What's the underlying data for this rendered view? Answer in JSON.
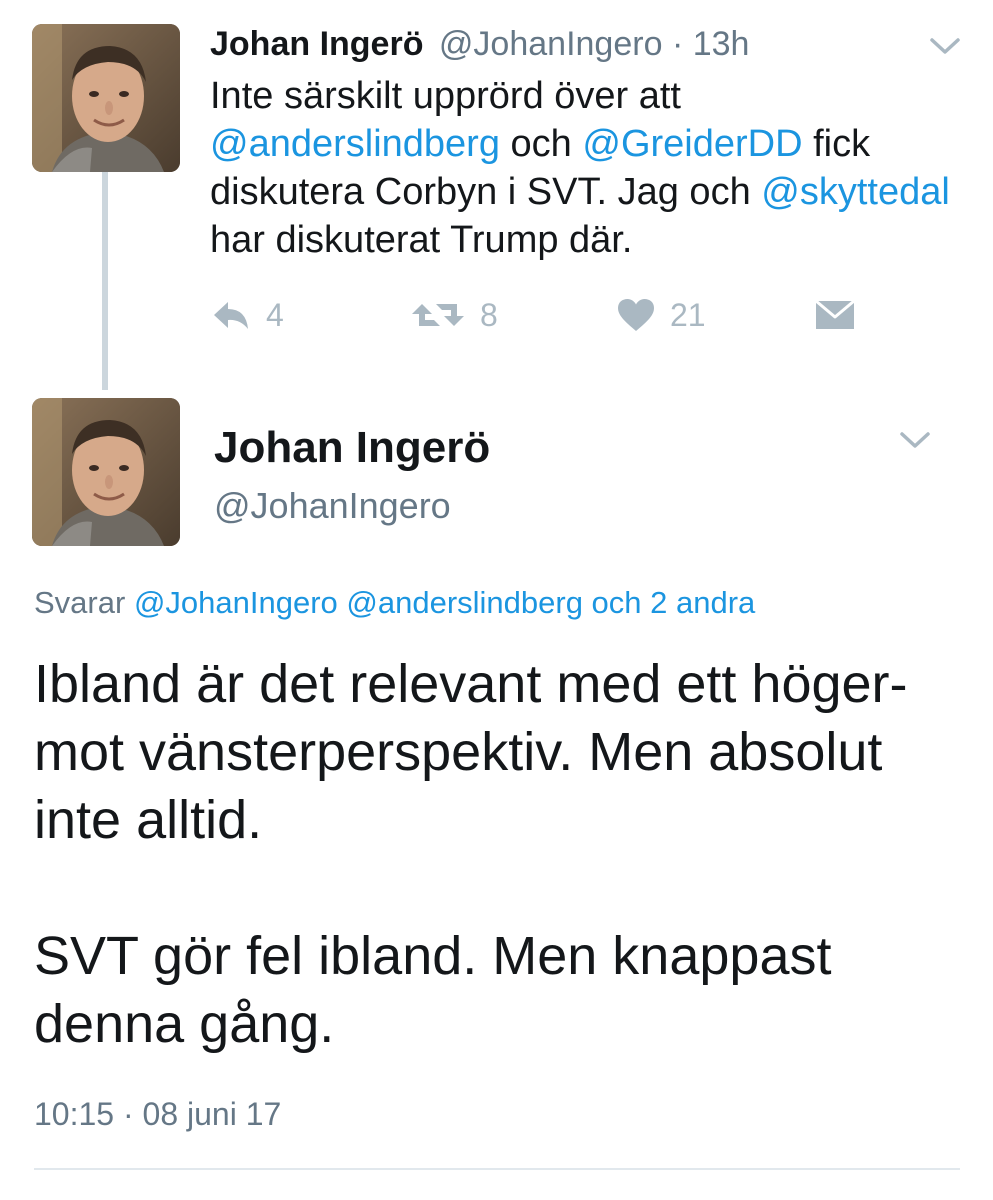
{
  "first_tweet": {
    "author_name": "Johan Ingerö",
    "handle": "@JohanIngero",
    "separator": "·",
    "time_ago": "13h",
    "text_segments": {
      "s1": "Inte särskilt upprörd över att ",
      "m1": "@anderslindberg",
      "s2": " och ",
      "m2": "@GreiderDD",
      "s3": " fick diskutera Corbyn i SVT. Jag och ",
      "m3": "@skyttedal",
      "s4": " har diskuterat Trump där."
    },
    "actions": {
      "reply_count": "4",
      "retweet_count": "8",
      "like_count": "21"
    }
  },
  "main_tweet": {
    "author_name": "Johan Ingerö",
    "handle": "@JohanIngero",
    "replying_to": {
      "prefix": "Svarar",
      "users": "@JohanIngero @anderslindberg och 2 andra"
    },
    "paragraphs": [
      "Ibland är det relevant med ett höger- mot vänsterperspektiv. Men absolut inte alltid.",
      "SVT gör fel ibland. Men knappast denna gång."
    ],
    "timestamp": "10:15 · 08 juni 17"
  },
  "colors": {
    "link": "#1b95e0",
    "secondary_text": "#657786",
    "action_icon": "#aab8c2",
    "thread_line": "#ccd6dd"
  },
  "icons": {
    "reply": "reply-icon",
    "retweet": "retweet-icon",
    "like": "heart-icon",
    "message": "envelope-icon",
    "menu": "chevron-down-icon"
  }
}
